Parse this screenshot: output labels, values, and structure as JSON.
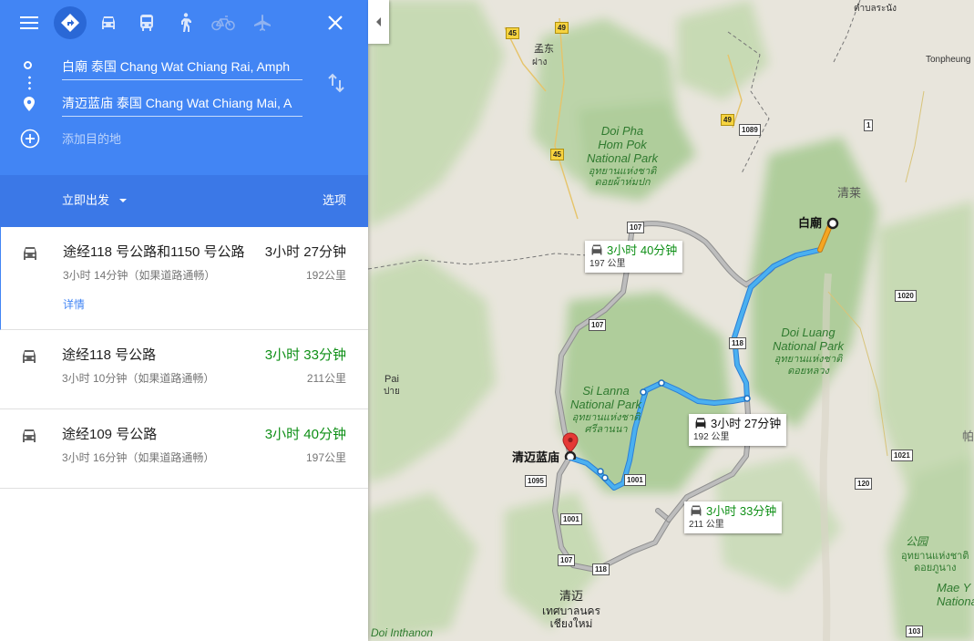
{
  "header": {
    "icons": [
      "menu-icon",
      "directions-icon",
      "car-icon",
      "transit-icon",
      "walk-icon",
      "bicycle-icon",
      "flight-icon",
      "close-icon"
    ],
    "origin": "白廟 泰国 Chang Wat Chiang Rai, Amph",
    "destination": "清迈蓝庙 泰国 Chang Wat Chiang Mai, A",
    "add_destination": "添加目的地"
  },
  "depart": {
    "label": "立即出发",
    "options": "选项"
  },
  "routes": [
    {
      "title": "途经118 号公路和1150 号公路",
      "time": "3小时 27分钟",
      "sub": "3小时 14分钟（如果道路通畅）",
      "distance": "192公里",
      "details": "详情",
      "time_color": "#212121"
    },
    {
      "title": "途经118 号公路",
      "time": "3小时 33分钟",
      "sub": "3小时 10分钟（如果道路通畅）",
      "distance": "211公里",
      "time_color": "#0e8f16"
    },
    {
      "title": "途经109 号公路",
      "time": "3小时 40分钟",
      "sub": "3小时 16分钟（如果道路通畅）",
      "distance": "197公里",
      "time_color": "#0e8f16"
    }
  ],
  "map": {
    "callouts": [
      {
        "time": "3小时 40分钟",
        "distance": "197 公里"
      },
      {
        "time": "3小时 27分钟",
        "distance": "192 公里"
      },
      {
        "time": "3小时 33分钟",
        "distance": "211 公里"
      }
    ],
    "origin_label": "白廟",
    "destination_label": "清迈蓝庙",
    "parks": [
      {
        "name": "Doi Pha Hom Pok National Park",
        "lines": [
          "Doi Pha",
          "Hom Pok",
          "National Park"
        ],
        "thai": [
          "อุทยานแห่งชาติ",
          "ดอยผ้าห่มปก"
        ]
      },
      {
        "name": "Doi Luang National Park",
        "lines": [
          "Doi Luang",
          "National Park"
        ],
        "thai": [
          "อุทยานแห่งชาติ",
          "ดอยหลวง"
        ]
      },
      {
        "name": "Si Lanna National Park",
        "lines": [
          "Si Lanna",
          "National Park"
        ],
        "thai": [
          "อุทยานแห่งชาติ",
          "ศรีลานนา"
        ]
      }
    ],
    "towns": {
      "mengdong": "孟东",
      "mengdong_thai": "ฝาง",
      "chiangrai": "清莱",
      "pai": "Pai",
      "pai_thai": "ปาย",
      "chiangmai": "清迈",
      "chiangmai_thai": "เทศบาลนคร เชียงใหม่",
      "tonpheung": "Tonpheung",
      "doi_inthanon": "Doi Inthanon",
      "park_right": "公园",
      "park_right_thai": [
        "อุทยานแห่งชาติ",
        "ดอยภูนาง"
      ],
      "mae_yom": [
        "Mae Y",
        "Nationa"
      ],
      "top_right_thai": "ตำบลระนัง",
      "far_right": "帕"
    },
    "shields": [
      "45",
      "49",
      "45",
      "49",
      "1089",
      "107",
      "107",
      "118",
      "1095",
      "1001",
      "1001",
      "107",
      "118",
      "1020",
      "1021",
      "120",
      "103",
      "1"
    ],
    "route_colors": {
      "selected": "#4a9ee8",
      "alternate": "#9e9e9e",
      "origin_segment": "#f5a623"
    }
  }
}
